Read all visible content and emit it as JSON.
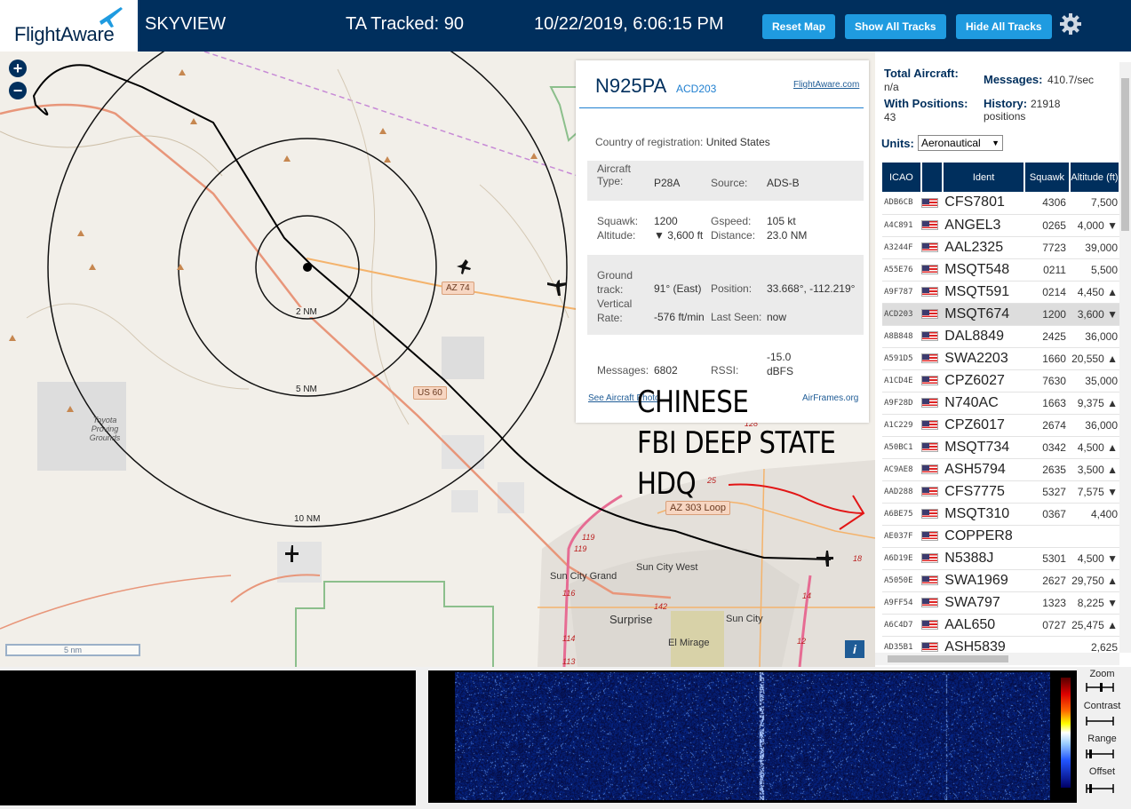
{
  "header": {
    "logo": "FlightAware",
    "app_title": "SKYVIEW",
    "ta_tracked": "TA Tracked: 90",
    "timestamp": "10/22/2019, 6:06:15 PM",
    "buttons": {
      "reset_map": "Reset Map",
      "show_all": "Show All Tracks",
      "hide_all": "Hide All Tracks"
    },
    "settings_icon": "gear-icon"
  },
  "map": {
    "zoom_in": "+",
    "zoom_out": "−",
    "range_labels": [
      "2 NM",
      "5 NM",
      "10 NM"
    ],
    "roads": [
      "AZ 74",
      "US 60",
      "AZ 303 Loop"
    ],
    "places": [
      "Toyota Proving Grounds",
      "Sun City West",
      "Sun City Grand",
      "Surprise",
      "Sun City",
      "El Mirage"
    ],
    "route_numbers": [
      "119",
      "119",
      "116",
      "114",
      "113",
      "142",
      "128",
      "25",
      "18",
      "14",
      "12"
    ],
    "scale": "5 nm",
    "info": "i",
    "annotation": [
      "CHINESE",
      "FBI DEEP STATE",
      "HDQ"
    ]
  },
  "popup": {
    "registration": "N925PA",
    "callsign": "ACD203",
    "link": "FlightAware.com",
    "country_label": "Country of registration:",
    "country": "United States",
    "aircraft_type_label": "Aircraft Type:",
    "aircraft_type": "P28A",
    "source_label": "Source:",
    "source": "ADS-B",
    "squawk_label": "Squawk:",
    "squawk": "1200",
    "altitude_label": "Altitude:",
    "altitude": "▼ 3,600 ft",
    "gspeed_label": "Gspeed:",
    "gspeed": "105 kt",
    "distance_label": "Distance:",
    "distance": "23.0 NM",
    "ground_track_label": "Ground track:",
    "ground_track": "91° (East)",
    "position_label": "Position:",
    "position": "33.668°, -112.219°",
    "vrate_label": "Vertical Rate:",
    "vrate": "-576 ft/min",
    "last_seen_label": "Last Seen:",
    "last_seen": "now",
    "messages_label": "Messages:",
    "messages": "6802",
    "rssi_label": "RSSI:",
    "rssi": "-15.0 dBFS",
    "photo_link": "See Aircraft Photo",
    "airframes_link": "AirFrames.org"
  },
  "sidebar": {
    "total_aircraft_label": "Total Aircraft:",
    "total_aircraft": "n/a",
    "messages_label": "Messages:",
    "messages": "410.7/sec",
    "with_positions_label": "With Positions:",
    "with_positions": "43",
    "history_label": "History:",
    "history": "21918 positions",
    "units_label": "Units:",
    "units_value": "Aeronautical",
    "columns": [
      "ICAO",
      "",
      "Ident",
      "Squawk",
      "Altitude (ft)"
    ],
    "rows": [
      {
        "icao": "ADB6CB",
        "ident": "CFS7801",
        "squawk": "4306",
        "alt": "7,500"
      },
      {
        "icao": "A4C891",
        "ident": "ANGEL3",
        "squawk": "0265",
        "alt": "4,000 ▼"
      },
      {
        "icao": "A3244F",
        "ident": "AAL2325",
        "squawk": "7723",
        "alt": "39,000"
      },
      {
        "icao": "A55E76",
        "ident": "MSQT548",
        "squawk": "0211",
        "alt": "5,500"
      },
      {
        "icao": "A9F787",
        "ident": "MSQT591",
        "squawk": "0214",
        "alt": "4,450 ▲"
      },
      {
        "icao": "ACD203",
        "ident": "MSQT674",
        "squawk": "1200",
        "alt": "3,600 ▼",
        "selected": true
      },
      {
        "icao": "A8B848",
        "ident": "DAL8849",
        "squawk": "2425",
        "alt": "36,000"
      },
      {
        "icao": "A591D5",
        "ident": "SWA2203",
        "squawk": "1660",
        "alt": "20,550 ▲"
      },
      {
        "icao": "A1CD4E",
        "ident": "CPZ6027",
        "squawk": "7630",
        "alt": "35,000"
      },
      {
        "icao": "A9F28D",
        "ident": "N740AC",
        "squawk": "1663",
        "alt": "9,375 ▲"
      },
      {
        "icao": "A1C229",
        "ident": "CPZ6017",
        "squawk": "2674",
        "alt": "36,000"
      },
      {
        "icao": "A50BC1",
        "ident": "MSQT734",
        "squawk": "0342",
        "alt": "4,500 ▲"
      },
      {
        "icao": "AC9AE8",
        "ident": "ASH5794",
        "squawk": "2635",
        "alt": "3,500 ▲"
      },
      {
        "icao": "AAD288",
        "ident": "CFS7775",
        "squawk": "5327",
        "alt": "7,575 ▼"
      },
      {
        "icao": "A6BE75",
        "ident": "MSQT310",
        "squawk": "0367",
        "alt": "4,400"
      },
      {
        "icao": "AE037F",
        "ident": "COPPER8",
        "squawk": "",
        "alt": ""
      },
      {
        "icao": "A6D19E",
        "ident": "N5388J",
        "squawk": "5301",
        "alt": "4,500 ▼"
      },
      {
        "icao": "A5050E",
        "ident": "SWA1969",
        "squawk": "2627",
        "alt": "29,750 ▲"
      },
      {
        "icao": "A9FF54",
        "ident": "SWA797",
        "squawk": "1323",
        "alt": "8,225 ▼"
      },
      {
        "icao": "A6C4D7",
        "ident": "AAL650",
        "squawk": "0727",
        "alt": "25,475 ▲"
      },
      {
        "icao": "AD35B1",
        "ident": "ASH5839",
        "squawk": "",
        "alt": "2,625"
      }
    ]
  },
  "waterfall": {
    "controls": [
      "Zoom",
      "Contrast",
      "Range",
      "Offset"
    ]
  },
  "colors": {
    "header_bg": "#002f5d",
    "button_bg": "#1f9be0",
    "accent_blue": "#1f7fd0"
  }
}
